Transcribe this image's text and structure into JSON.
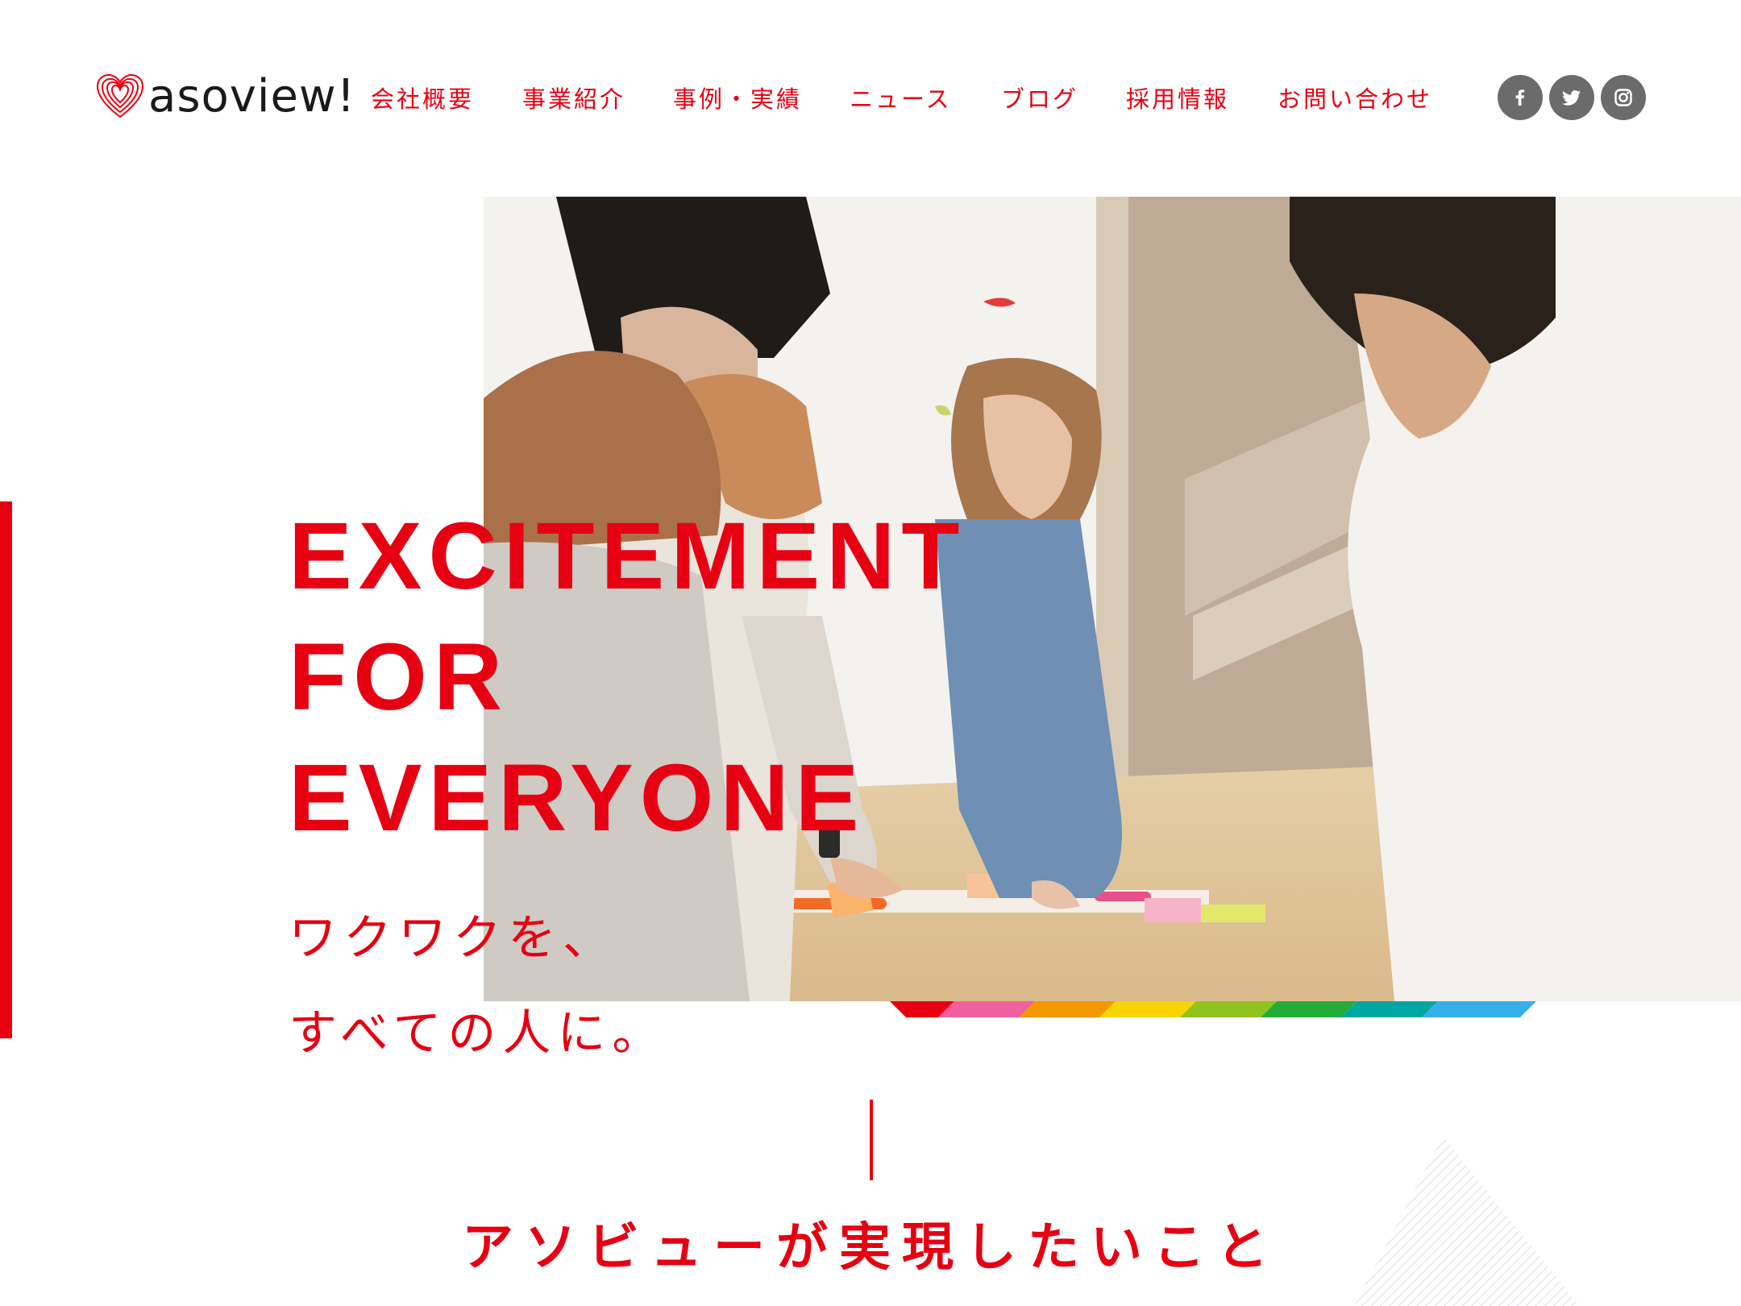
{
  "brand": {
    "logo_text": "asoview!"
  },
  "nav": {
    "items": [
      {
        "label": "会社概要"
      },
      {
        "label": "事業紹介"
      },
      {
        "label": "事例・実績"
      },
      {
        "label": "ニュース"
      },
      {
        "label": "ブログ"
      },
      {
        "label": "採用情報"
      },
      {
        "label": "お問い合わせ"
      }
    ]
  },
  "social": {
    "icons": [
      "facebook-icon",
      "twitter-icon",
      "instagram-icon"
    ]
  },
  "hero": {
    "tagline_lines": [
      "EXCITEMENT",
      "FOR",
      "EVERYONE"
    ],
    "subcopy_lines": [
      "ワクワクを、",
      "すべての人に。"
    ]
  },
  "section": {
    "title": "アソビューが実現したいこと"
  },
  "colors": {
    "accent": "#e60012",
    "social_bg": "#6b6b6b",
    "rainbow": [
      "#e60012",
      "#f0609e",
      "#f39800",
      "#f8d500",
      "#8fc31f",
      "#22ac38",
      "#00a6a3",
      "#36b0e8"
    ]
  }
}
